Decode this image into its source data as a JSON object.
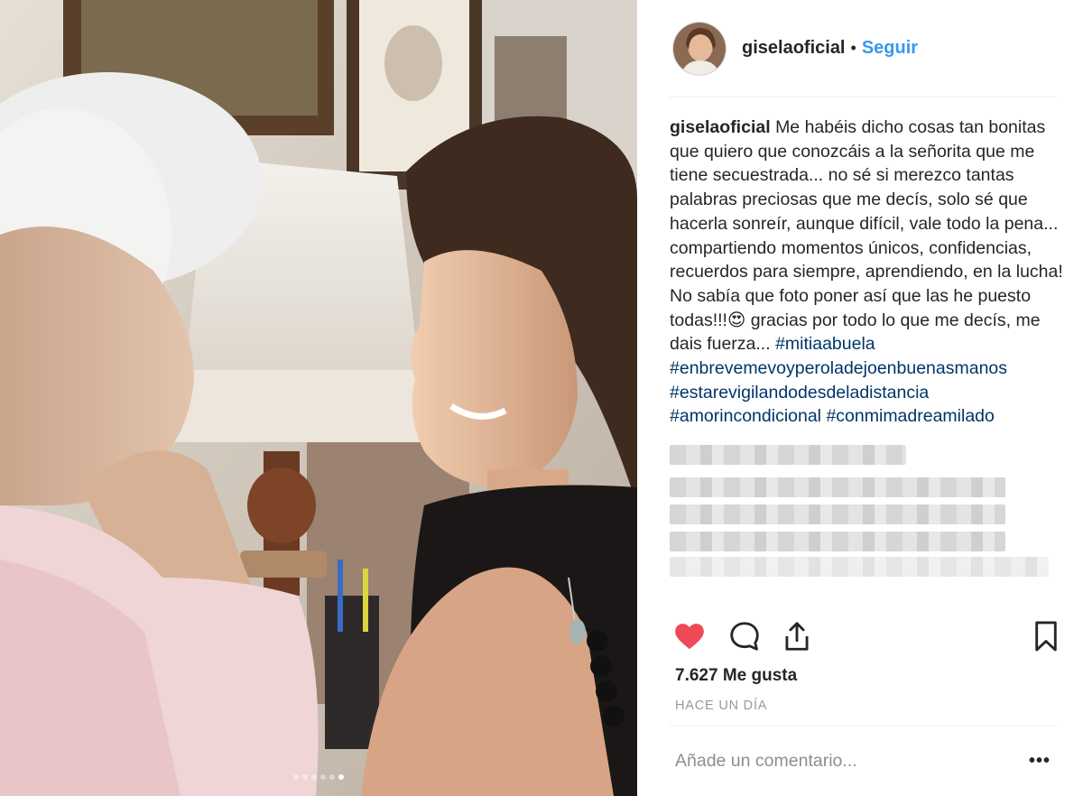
{
  "post": {
    "username": "giselaoficial",
    "separator": "•",
    "follow_label": "Seguir",
    "caption": {
      "username": "giselaoficial",
      "text": "Me habéis dicho cosas tan bonitas que quiero que conozcáis a la señorita que me tiene secuestrada... no sé si merezco tantas palabras preciosas que me decís, solo sé que hacerla sonreír, aunque difícil, vale todo la pena... compartiendo momentos únicos, confidencias, recuerdos para siempre, aprendiendo, en la lucha!\nNo sabía que foto poner así que las he puesto todas!!!😍  gracias por todo lo que me decís, me dais fuerza... ",
      "hashtags": [
        "#mitiaabuela",
        "#enbrevemevoyperoladejoenbuenasmanos",
        "#estarevigilandodesdeladistancia",
        "#amorincondicional",
        "#conmimadreamilado"
      ]
    },
    "likes_count": "7.627",
    "likes_label": "Me gusta",
    "timestamp": "HACE UN DÍA",
    "comment_placeholder": "Añade un comentario...",
    "more_label": "•••"
  },
  "icons": {
    "like": "heart-filled-icon",
    "comment": "comment-bubble-icon",
    "share": "share-upload-icon",
    "save": "bookmark-icon",
    "more": "ellipsis-icon"
  },
  "colors": {
    "link": "#3897f0",
    "hashtag": "#003569",
    "like": "#ed4956",
    "text": "#262626",
    "muted": "#999999"
  }
}
